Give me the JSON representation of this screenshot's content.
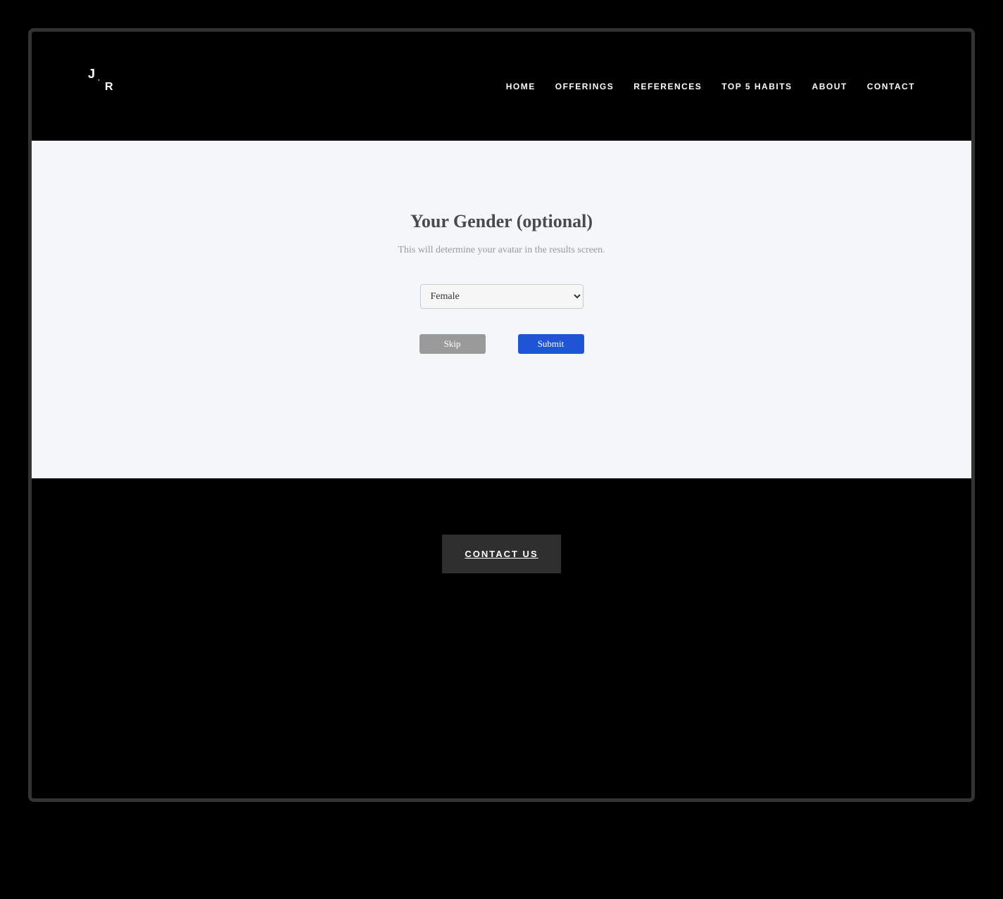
{
  "logo": {
    "text1": "J",
    "text2": "R",
    "separator": "·"
  },
  "nav": {
    "items": [
      {
        "label": "HOME"
      },
      {
        "label": "OFFERINGS"
      },
      {
        "label": "REFERENCES"
      },
      {
        "label": "TOP 5 HABITS"
      },
      {
        "label": "ABOUT"
      },
      {
        "label": "CONTACT"
      }
    ]
  },
  "form": {
    "title": "Your Gender (optional)",
    "subtitle": "This will determine your avatar in the results screen.",
    "select": {
      "selected": "Female"
    },
    "buttons": {
      "skip": "Skip",
      "submit": "Submit"
    }
  },
  "footer": {
    "contact_label": "CONTACT US"
  }
}
